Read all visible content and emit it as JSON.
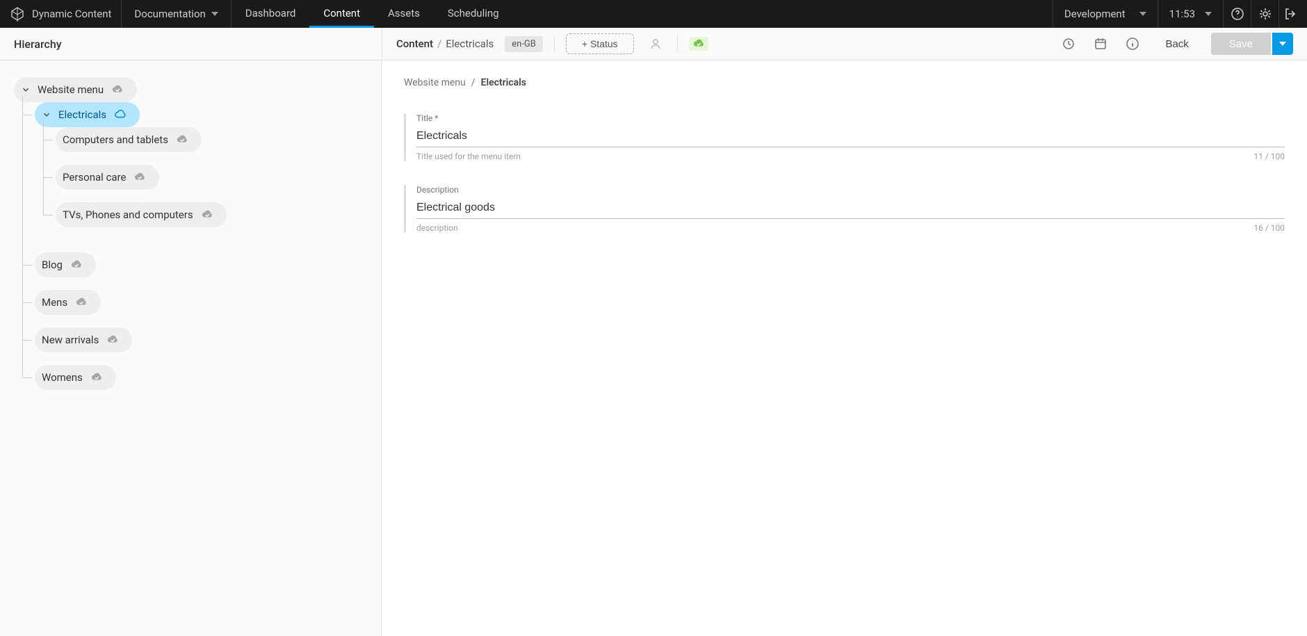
{
  "app": {
    "name": "Dynamic Content"
  },
  "topbar": {
    "documentation": "Documentation",
    "nav": [
      {
        "label": "Dashboard"
      },
      {
        "label": "Content"
      },
      {
        "label": "Assets"
      },
      {
        "label": "Scheduling"
      }
    ],
    "activeNavIndex": 1,
    "environment": "Development",
    "time": "11:53"
  },
  "subheader": {
    "leftTitle": "Hierarchy",
    "crumb": {
      "label": "Content",
      "sep": "/",
      "current": "Electricals"
    },
    "locale": "en-GB",
    "statusLabel": "+ Status",
    "back": "Back",
    "save": "Save"
  },
  "tree": {
    "root": {
      "label": "Website menu",
      "expanded": true,
      "children": [
        {
          "label": "Electricals",
          "active": true,
          "expanded": true,
          "children": [
            {
              "label": "Computers and tablets"
            },
            {
              "label": "Personal care"
            },
            {
              "label": "TVs, Phones and computers"
            }
          ]
        },
        {
          "label": "Blog"
        },
        {
          "label": "Mens"
        },
        {
          "label": "New arrivals"
        },
        {
          "label": "Womens"
        }
      ]
    }
  },
  "breadcrumb": {
    "parent": "Website menu",
    "sep": "/",
    "current": "Electricals"
  },
  "form": {
    "title": {
      "label": "Title *",
      "value": "Electricals",
      "helper": "Title used for the menu item",
      "count": "11 / 100"
    },
    "description": {
      "label": "Description",
      "value": "Electrical goods",
      "helper": "description",
      "count": "16 / 100"
    }
  }
}
